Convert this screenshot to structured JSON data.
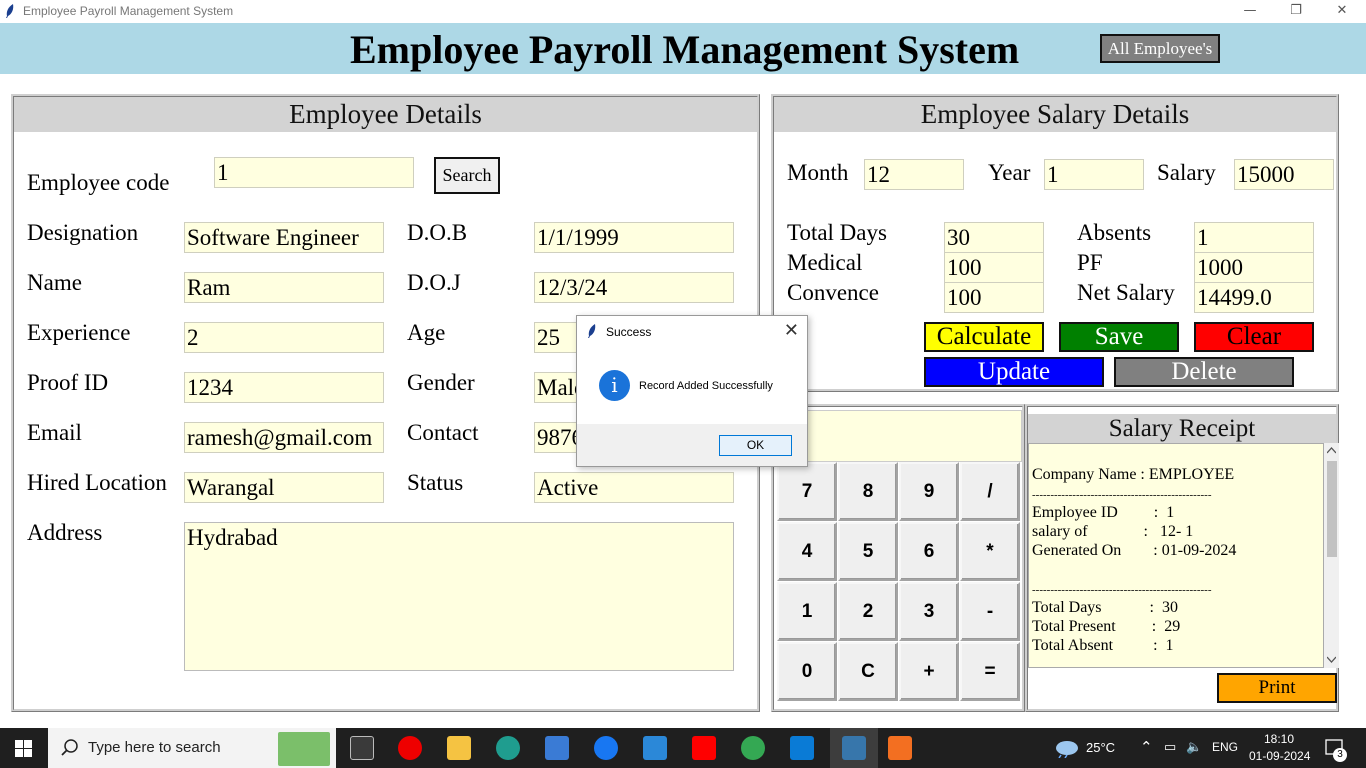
{
  "window": {
    "title": "Employee Payroll Management System",
    "minimize": "—",
    "maximize": "❐",
    "close": "✕"
  },
  "header": {
    "title": "Employee Payroll Management System",
    "all_employees_button": "All Employee's"
  },
  "employee_details": {
    "heading": "Employee Details",
    "code_label": "Employee code",
    "code_value": "1",
    "search_button": "Search",
    "designation_label": "Designation",
    "designation_value": "Software Engineer",
    "dob_label": "D.O.B",
    "dob_value": "1/1/1999",
    "name_label": "Name",
    "name_value": "Ram",
    "doj_label": "D.O.J",
    "doj_value": "12/3/24",
    "experience_label": "Experience",
    "experience_value": "2",
    "age_label": "Age",
    "age_value": "25",
    "proof_label": "Proof  ID",
    "proof_value": "1234",
    "gender_label": "Gender",
    "gender_value": "Male",
    "email_label": "Email",
    "email_value": "ramesh@gmail.com",
    "contact_label": "Contact",
    "contact_value": "9876",
    "location_label": "Hired Location",
    "location_value": "Warangal",
    "status_label": "Status",
    "status_value": "Active",
    "address_label": "Address",
    "address_value": "Hydrabad"
  },
  "salary_details": {
    "heading": "Employee Salary Details",
    "month_label": "Month",
    "month_value": "12",
    "year_label": "Year",
    "year_value": "1",
    "salary_label": "Salary",
    "salary_value": "15000",
    "total_days_label": "Total Days",
    "total_days_value": "30",
    "absents_label": "Absents",
    "absents_value": "1",
    "medical_label": "Medical",
    "medical_value": "100",
    "pf_label": "PF",
    "pf_value": "1000",
    "convence_label": "Convence",
    "convence_value": "100",
    "net_salary_label": "Net Salary",
    "net_salary_value": "14499.0",
    "buttons": {
      "calculate": "Calculate",
      "save": "Save",
      "clear": "Clear",
      "update": "Update",
      "delete": "Delete"
    }
  },
  "calculator": {
    "display": "",
    "keys": [
      "7",
      "8",
      "9",
      "/",
      "4",
      "5",
      "6",
      "*",
      "1",
      "2",
      "3",
      "-",
      "0",
      "C",
      "+",
      "="
    ]
  },
  "receipt": {
    "heading": "Salary Receipt",
    "company": "Company Name : EMPLOYEE",
    "divider": "-------------------------------------------------",
    "employee_id": "Employee ID         :  1",
    "salary_of": "salary of              :   12- 1",
    "generated_on": "Generated On        : 01-09-2024",
    "divider2": "-------------------------------------------------",
    "total_days": "Total Days            :  30",
    "total_present": "Total Present         :  29",
    "total_absent": "Total Absent          :  1",
    "print_button": "Print"
  },
  "dialog": {
    "title": "Success",
    "message": "Record Added Successfully",
    "ok": "OK",
    "close": "✕",
    "icon": "i"
  },
  "taskbar": {
    "search_placeholder": "Type here to search",
    "weather": "25°C",
    "language": "ENG",
    "time": "18:10",
    "date": "01-09-2024",
    "notifications": "3"
  },
  "colors": {
    "header_bg": "#add8e6",
    "entry_bg": "#ffffe0",
    "calculate": "#ffff00",
    "save": "#008000",
    "clear": "#ff0000",
    "update": "#0000ff",
    "delete": "#808080",
    "print": "#ffa500"
  }
}
